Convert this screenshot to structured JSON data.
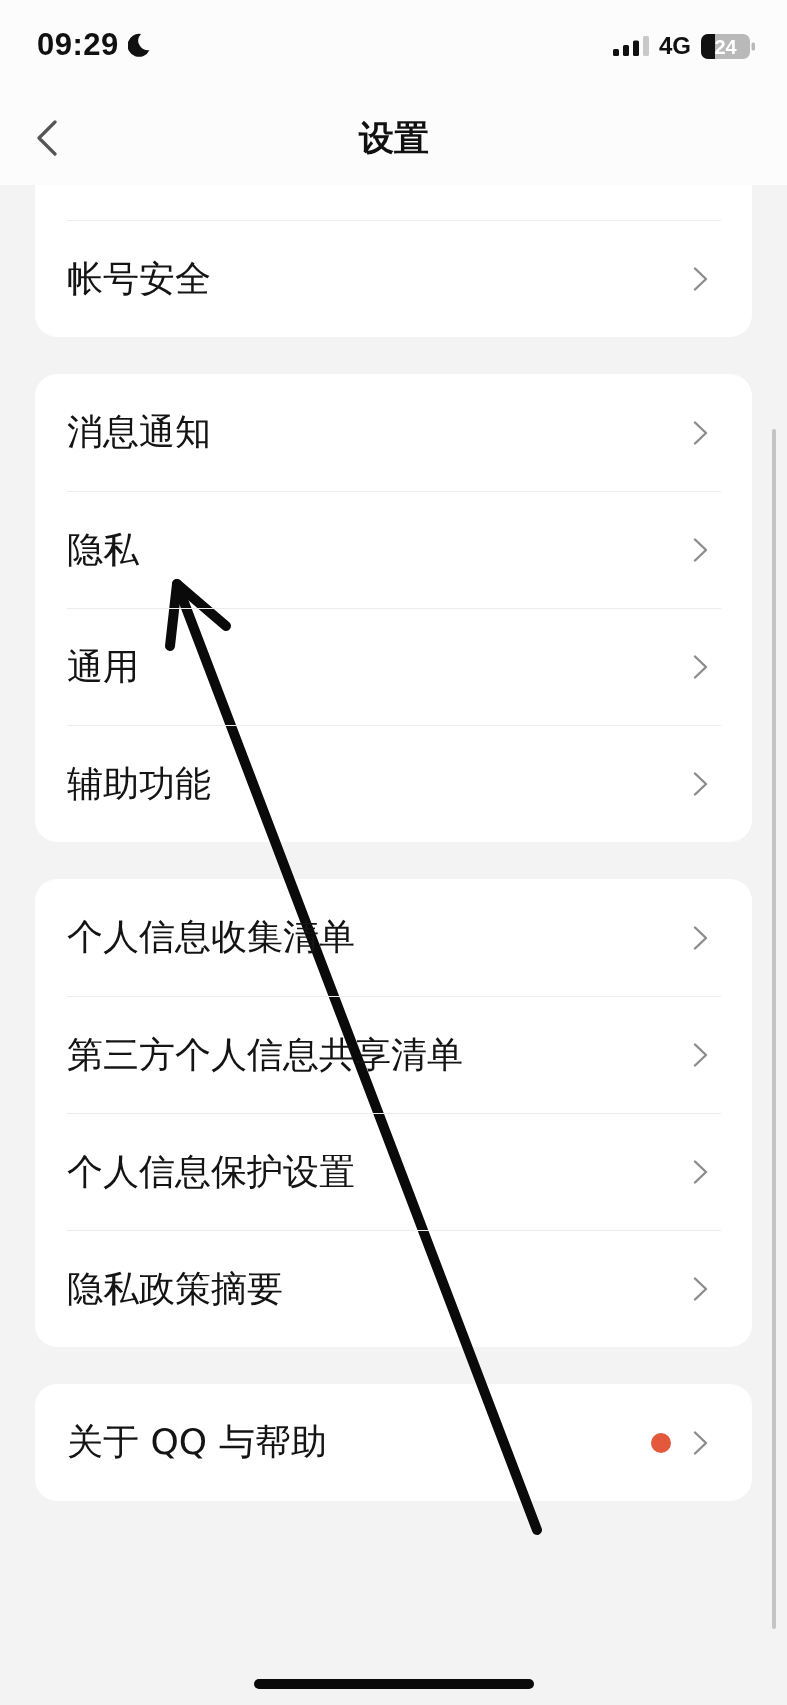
{
  "status_bar": {
    "time": "09:29",
    "network": "4G",
    "battery": "24"
  },
  "nav_bar": {
    "title": "设置"
  },
  "groups": [
    {
      "items": [
        {
          "label": "帐号安全",
          "new_badge": false
        }
      ]
    },
    {
      "items": [
        {
          "label": "消息通知",
          "new_badge": false
        },
        {
          "label": "隐私",
          "new_badge": false
        },
        {
          "label": "通用",
          "new_badge": false
        },
        {
          "label": "辅助功能",
          "new_badge": false
        }
      ]
    },
    {
      "items": [
        {
          "label": "个人信息收集清单",
          "new_badge": false
        },
        {
          "label": "第三方个人信息共享清单",
          "new_badge": false
        },
        {
          "label": "个人信息保护设置",
          "new_badge": false
        },
        {
          "label": "隐私政策摘要",
          "new_badge": false
        }
      ]
    },
    {
      "items": [
        {
          "label": "关于 QQ 与帮助",
          "new_badge": true
        }
      ]
    }
  ]
}
